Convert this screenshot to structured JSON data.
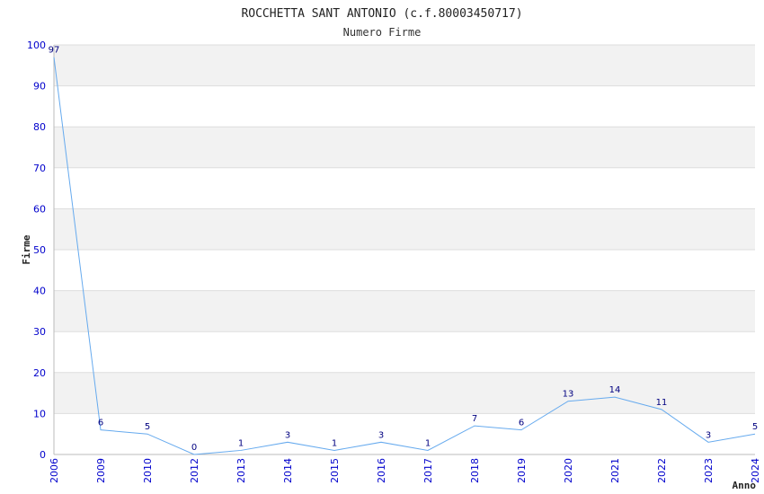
{
  "chart_data": {
    "type": "line",
    "title": "ROCCHETTA SANT ANTONIO (c.f.80003450717)",
    "subtitle": "Numero Firme",
    "xlabel": "Anno",
    "ylabel": "Firme",
    "ylim": [
      0,
      100
    ],
    "yticks": [
      "0",
      "10",
      "20",
      "30",
      "40",
      "50",
      "60",
      "70",
      "80",
      "90",
      "100"
    ],
    "categories": [
      "2006",
      "2009",
      "2010",
      "2012",
      "2013",
      "2014",
      "2015",
      "2016",
      "2017",
      "2018",
      "2019",
      "2020",
      "2021",
      "2022",
      "2023",
      "2024"
    ],
    "values": [
      97,
      6,
      5,
      0,
      1,
      3,
      1,
      3,
      1,
      7,
      6,
      13,
      14,
      11,
      3,
      5
    ],
    "data_labels": [
      "97",
      "6",
      "5",
      "0",
      "1",
      "3",
      "1",
      "3",
      "1",
      "7",
      "6",
      "13",
      "14",
      "11",
      "3",
      "5"
    ],
    "grid": true,
    "colors": {
      "line": "#66aaee",
      "band": "#f2f2f2",
      "grid": "#dddddd",
      "tick_text": "#0000cc",
      "data_text": "#000080"
    }
  }
}
